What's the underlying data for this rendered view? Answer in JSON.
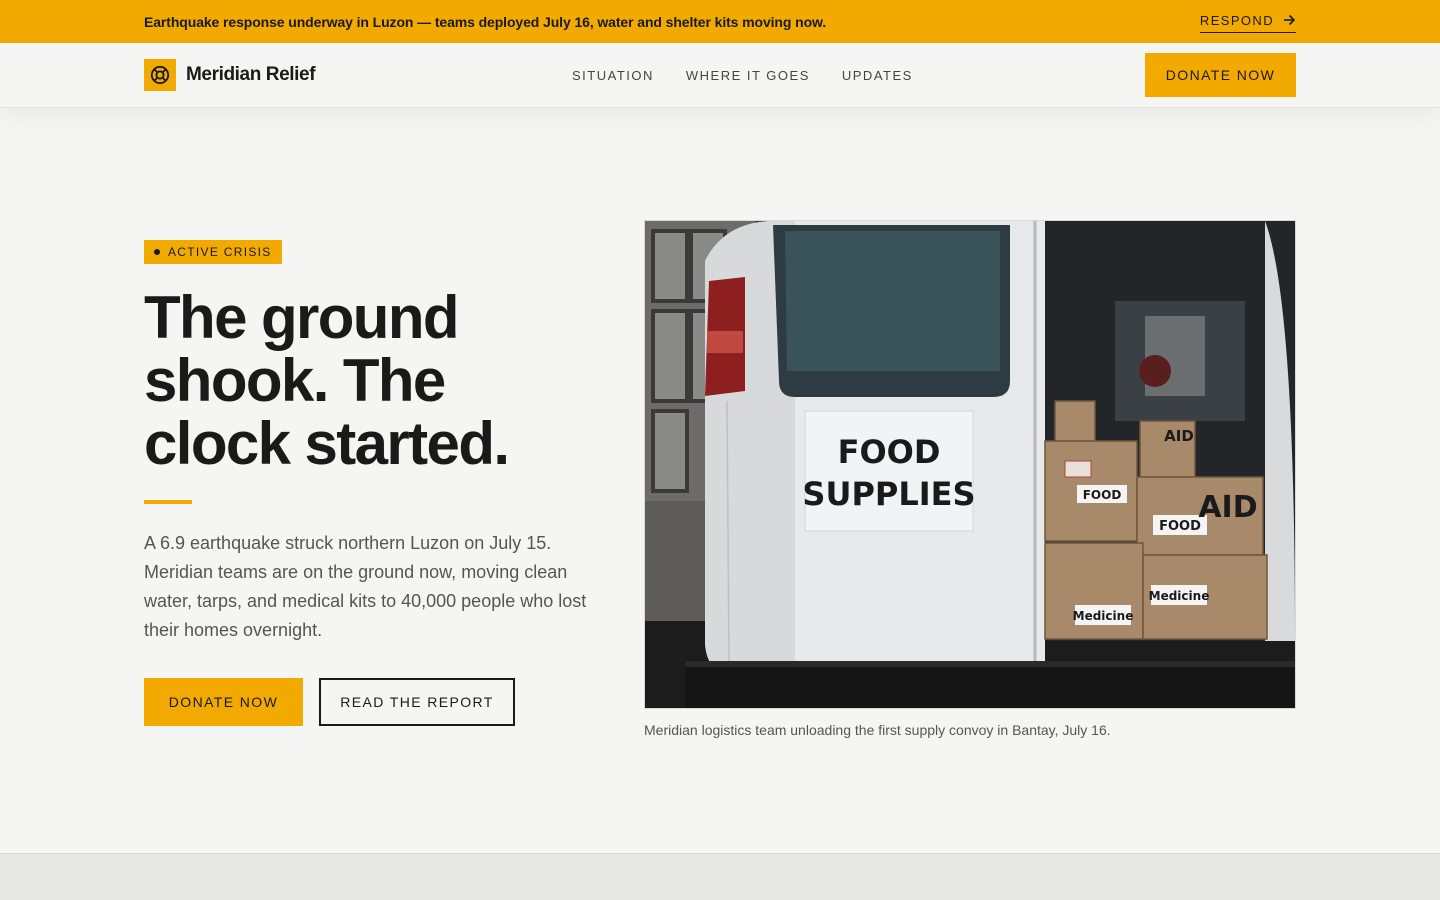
{
  "alert": {
    "text": "Earthquake response underway in Luzon — teams deployed July 16, water and shelter kits moving now.",
    "link_label": "RESPOND",
    "link_icon": "arrow-right-icon"
  },
  "brand": {
    "name": "Meridian Relief",
    "logo_icon": "lifebuoy-icon"
  },
  "nav": {
    "items": [
      {
        "label": "SITUATION"
      },
      {
        "label": "WHERE IT GOES"
      },
      {
        "label": "UPDATES"
      }
    ]
  },
  "header": {
    "cta_label": "DONATE NOW"
  },
  "hero": {
    "badge": "ACTIVE CRISIS",
    "headline": "The ground shook. The clock started.",
    "lede": "A 6.9 earthquake struck northern Luzon on July 15. Meridian teams are on the ground now, moving clean water, tarps, and medical kits to 40,000 people who lost their homes overnight.",
    "primary_cta": "DONATE NOW",
    "secondary_cta": "READ THE REPORT"
  },
  "photo": {
    "door_sign_line1": "FOOD",
    "door_sign_line2": "SUPPLIES",
    "box_labels": [
      "AID",
      "FOOD",
      "FOOD",
      "AID",
      "Medicine",
      "Medicine"
    ],
    "caption": "Meridian logistics team unloading the first supply convoy in Bantay, July 16."
  },
  "colors": {
    "accent": "#f2aa00",
    "background": "#f5f5f3",
    "ink": "#1a1a1a"
  }
}
